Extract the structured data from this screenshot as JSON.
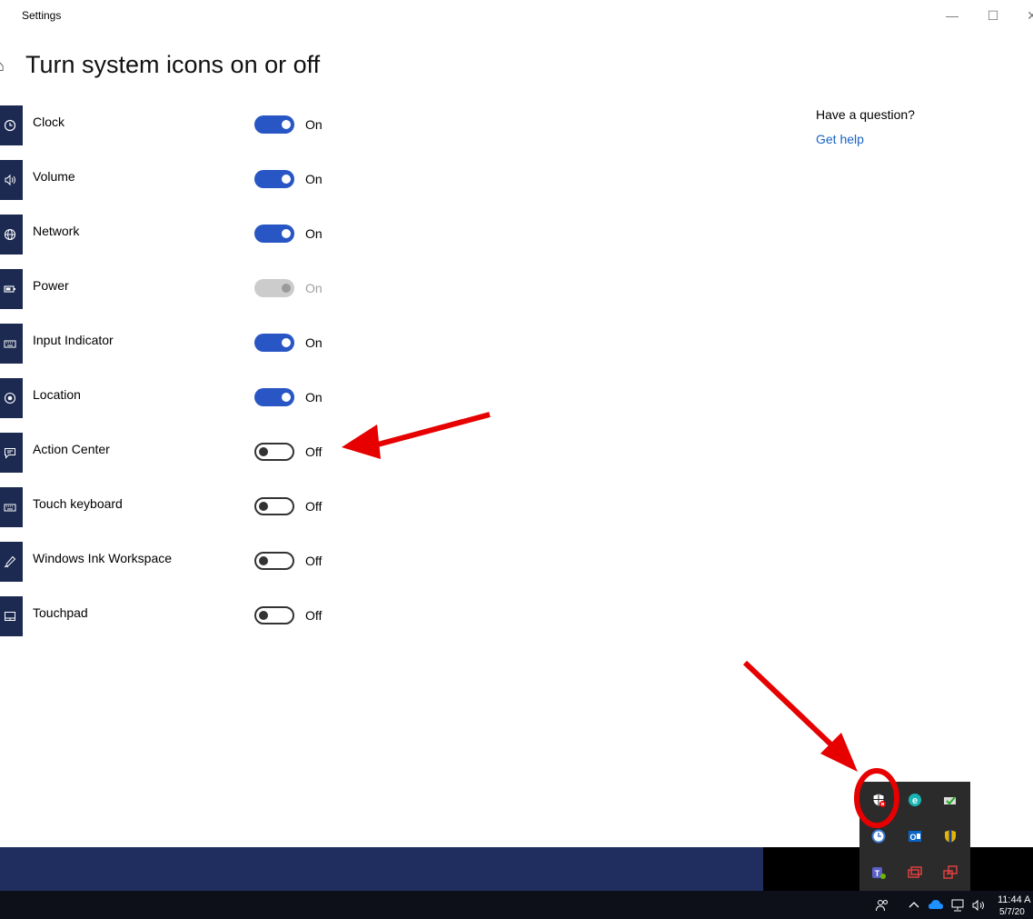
{
  "window": {
    "title": "Settings"
  },
  "page": {
    "title": "Turn system icons on or off"
  },
  "settings": [
    {
      "label": "Clock",
      "state": "On",
      "mode": "on"
    },
    {
      "label": "Volume",
      "state": "On",
      "mode": "on"
    },
    {
      "label": "Network",
      "state": "On",
      "mode": "on"
    },
    {
      "label": "Power",
      "state": "On",
      "mode": "disabled"
    },
    {
      "label": "Input Indicator",
      "state": "On",
      "mode": "on"
    },
    {
      "label": "Location",
      "state": "On",
      "mode": "on"
    },
    {
      "label": "Action Center",
      "state": "Off",
      "mode": "off"
    },
    {
      "label": "Touch keyboard",
      "state": "Off",
      "mode": "off"
    },
    {
      "label": "Windows Ink Workspace",
      "state": "Off",
      "mode": "off"
    },
    {
      "label": "Touchpad",
      "state": "Off",
      "mode": "off"
    }
  ],
  "help": {
    "question": "Have a question?",
    "link": "Get help"
  },
  "taskbar": {
    "time": "11:44 A",
    "date": "5/7/20"
  },
  "colors": {
    "toggle_on": "#2856c4",
    "link": "#1964c4",
    "annotation": "#e60000"
  }
}
